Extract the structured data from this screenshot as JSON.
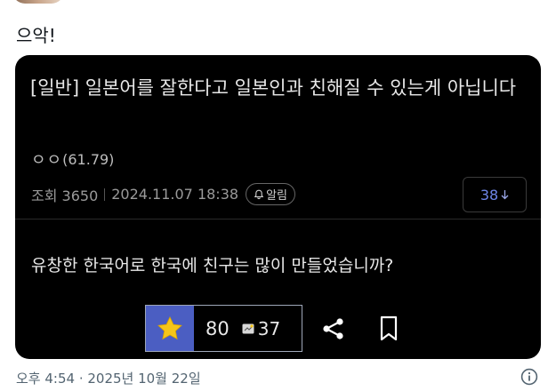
{
  "tweet": {
    "text": "으악!",
    "timestamp": "오후 4:54 · 2025년 10월 22일"
  },
  "post": {
    "title": "[일반] 일본어를 잘한다고 일본인과 친해질 수 있는게 아닙니다",
    "author_nick": "ㅇㅇ",
    "author_ip": "(61.79)",
    "views_label": "조회 3650",
    "date": "2024.11.07 18:38",
    "alarm_label": "알림",
    "comment_count": "38",
    "body": "유창한 한국어로 한국에 친구는 많이 만들었습니까?",
    "recommend_count": "80",
    "fixed_count": "37"
  },
  "colors": {
    "card_bg": "#000000",
    "star_bg": "#4b5ec2",
    "star_fill": "#f5c518",
    "comment_accent": "#6e86e8"
  },
  "icons": [
    "avatar",
    "bell-icon",
    "arrow-down-icon",
    "star-icon",
    "fixed-icon",
    "share-icon",
    "bookmark-icon",
    "info-icon"
  ]
}
